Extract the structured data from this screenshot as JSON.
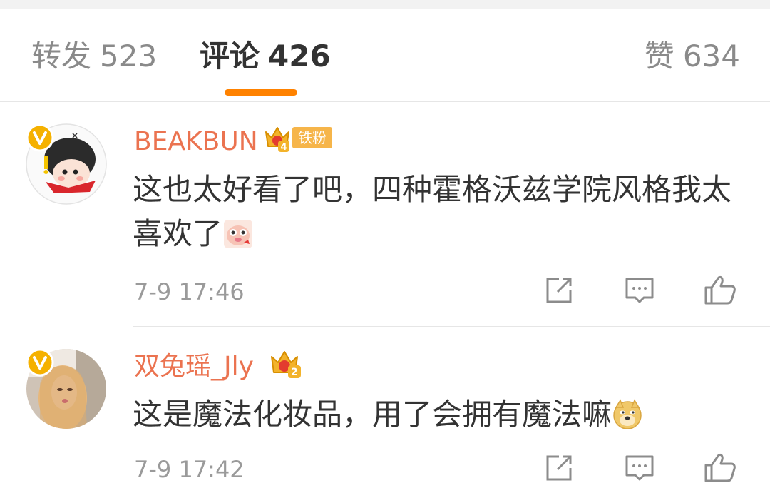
{
  "tabs": {
    "repost": {
      "label": "转发",
      "count": "523"
    },
    "comments": {
      "label": "评论",
      "count": "426"
    },
    "likes": {
      "label": "赞",
      "count": "634"
    }
  },
  "comments": [
    {
      "username": "BEAKBUN",
      "crown_level": "4",
      "fan_badge": "铁粉",
      "text": "这也太好看了吧，四种霍格沃兹学院风格我太喜欢了",
      "emoji": "cute-pig-emoji",
      "time": "7-9 17:46",
      "verified": true
    },
    {
      "username": "双兔瑶_Jly",
      "crown_level": "2",
      "text": "这是魔法化妆品，用了会拥有魔法嘛",
      "emoji": "doge-emoji",
      "time": "7-9 17:42",
      "verified": true
    }
  ],
  "colors": {
    "accent": "#ff8200",
    "username": "#eb7350",
    "badge": "#f6b54a",
    "verified": "#f5b100"
  }
}
